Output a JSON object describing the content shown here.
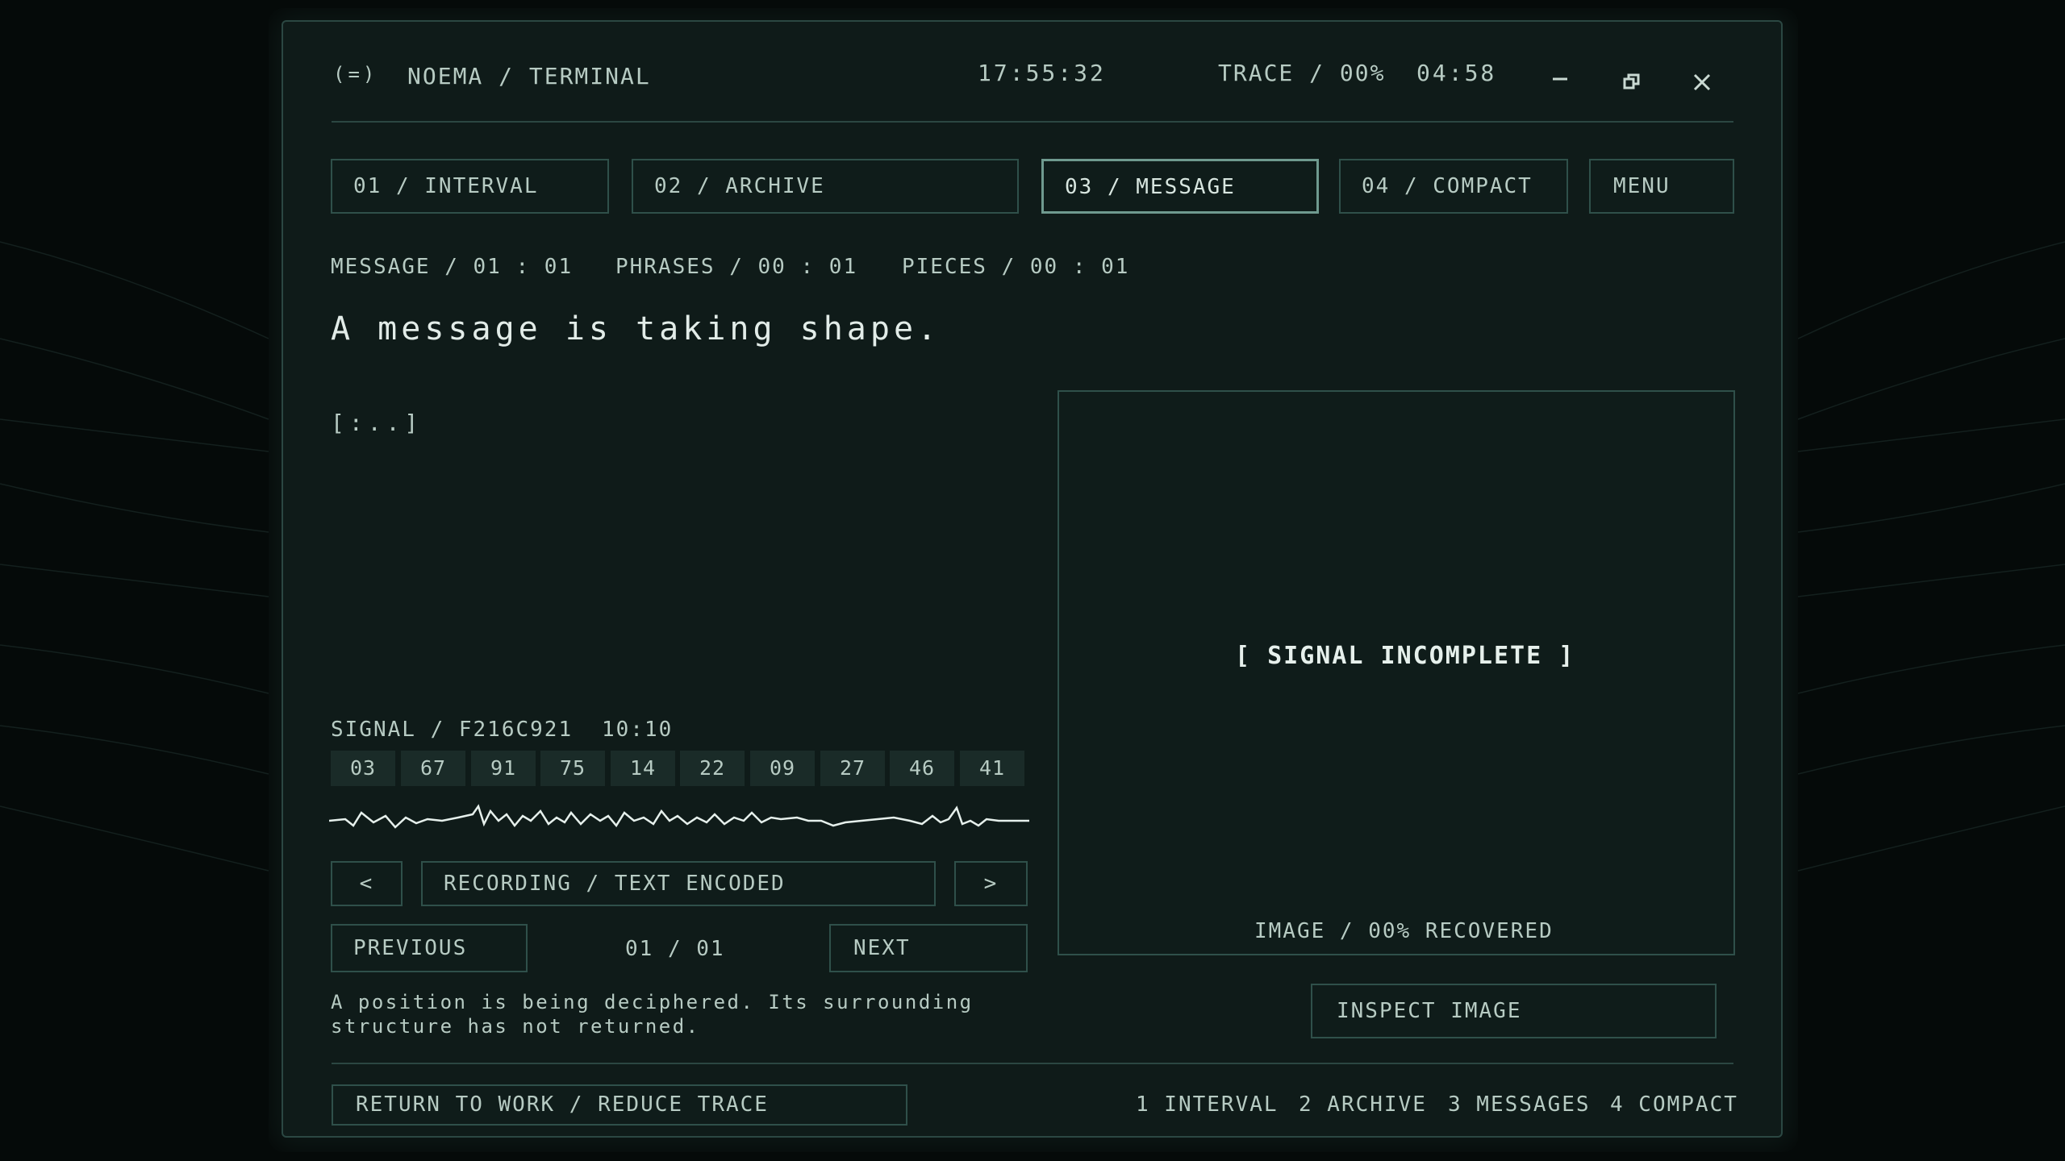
{
  "titlebar": {
    "logo": "(=)",
    "title": "NOEMA / TERMINAL",
    "clock": "17:55:32",
    "trace": "TRACE / 00%",
    "timer": "04:58"
  },
  "tabs": [
    {
      "label": "01 / INTERVAL"
    },
    {
      "label": "02 / ARCHIVE"
    },
    {
      "label": "03 / MESSAGE",
      "active": true
    },
    {
      "label": "04 / COMPACT"
    },
    {
      "label": "MENU"
    }
  ],
  "status": {
    "message": "MESSAGE / 01 : 01",
    "phrases": "PHRASES / 00 : 01",
    "pieces": "PIECES / 00 : 01"
  },
  "headline": "A message is taking shape.",
  "placeholder": "[:..]",
  "signal": {
    "id": "SIGNAL / F216C921",
    "time": "10:10",
    "values": [
      "03",
      "67",
      "91",
      "75",
      "14",
      "22",
      "09",
      "27",
      "46",
      "41"
    ]
  },
  "recorder": {
    "prev_glyph": "<",
    "label": "RECORDING / TEXT ENCODED",
    "next_glyph": ">"
  },
  "pager": {
    "previous": "PREVIOUS",
    "count": "01 / 01",
    "next": "NEXT"
  },
  "description": {
    "line1": "A position is being deciphered. Its surrounding",
    "line2": "structure has not returned."
  },
  "image_panel": {
    "status": "[ SIGNAL INCOMPLETE ]",
    "recovered": "IMAGE / 00% RECOVERED",
    "recovered_fraction": 0.0,
    "inspect": "INSPECT IMAGE"
  },
  "footer": {
    "return": "RETURN TO WORK / REDUCE TRACE",
    "shortcuts": [
      "1 INTERVAL",
      "2 ARCHIVE",
      "3 MESSAGES",
      "4 COMPACT"
    ]
  },
  "colors": {
    "background": "#050a09",
    "panel": "#0f1b19",
    "border": "#2f504a",
    "text": "#b7cbc3",
    "highlight": "#e6f0ec"
  }
}
